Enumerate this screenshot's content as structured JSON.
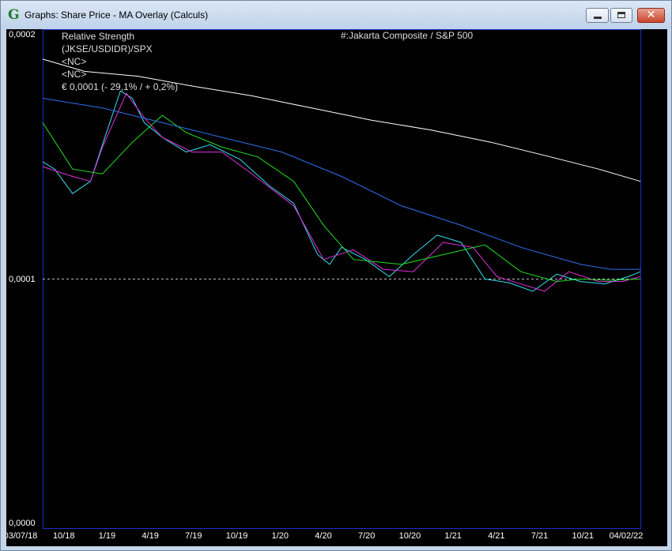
{
  "window": {
    "title": "Graphs: Share Price - MA Overlay (Calculs)",
    "icon": "G",
    "close_glyph": "✕"
  },
  "legend": {
    "lines": [
      "Relative Strength",
      "(JKSE/USDIDR)/SPX",
      "<NC>",
      "<NC>",
      "€ 0,0001 (- 29,1% / + 0,2%)"
    ],
    "series_title": "#:Jakarta Composite / S&P 500"
  },
  "chart_data": {
    "type": "line",
    "y_axis": {
      "ticks": [
        "0,0002",
        "0,0001",
        "0,0000"
      ],
      "ylim": [
        0,
        0.0002
      ],
      "reference_line": 0.0001
    },
    "x_axis": {
      "ticks": [
        "03/07/18",
        "10/18",
        "1/19",
        "4/19",
        "7/19",
        "10/19",
        "1/20",
        "4/20",
        "7/20",
        "10/20",
        "1/21",
        "4/21",
        "7/21",
        "10/21",
        "04/02/22"
      ],
      "range": [
        "2018-07-03",
        "2022-02-04"
      ]
    },
    "grid": false,
    "series": [
      {
        "color": "#33e0f0",
        "x": [
          0,
          0.02,
          0.05,
          0.08,
          0.1,
          0.13,
          0.15,
          0.17,
          0.2,
          0.24,
          0.28,
          0.33,
          0.38,
          0.42,
          0.46,
          0.48,
          0.5,
          0.54,
          0.58,
          0.62,
          0.66,
          0.7,
          0.74,
          0.78,
          0.82,
          0.86,
          0.9,
          0.94,
          0.98,
          1.0
        ],
        "values": [
          0.000148,
          0.000145,
          0.000135,
          0.00014,
          0.000155,
          0.000177,
          0.000174,
          0.000164,
          0.000158,
          0.000152,
          0.000155,
          0.000149,
          0.000138,
          0.000131,
          0.00011,
          0.000106,
          0.000113,
          0.000108,
          0.000101,
          0.00011,
          0.000118,
          0.000115,
          0.0001,
          9.85e-05,
          9.5e-05,
          0.000102,
          9.9e-05,
          9.8e-05,
          0.000101,
          0.000103
        ]
      },
      {
        "color": "#e030e0",
        "x": [
          0,
          0.05,
          0.08,
          0.1,
          0.14,
          0.17,
          0.2,
          0.25,
          0.3,
          0.35,
          0.42,
          0.47,
          0.52,
          0.57,
          0.62,
          0.67,
          0.72,
          0.76,
          0.8,
          0.84,
          0.88,
          0.93,
          0.97,
          1.0
        ],
        "values": [
          0.000146,
          0.000142,
          0.00014,
          0.000154,
          0.000176,
          0.000166,
          0.000158,
          0.000152,
          0.000152,
          0.000143,
          0.00013,
          0.000108,
          0.000112,
          0.000104,
          0.000103,
          0.000115,
          0.000113,
          0.000101,
          9.8e-05,
          9.5e-05,
          0.000103,
          9.9e-05,
          9.9e-05,
          0.000101
        ]
      },
      {
        "color": "#20e020",
        "x": [
          0,
          0.05,
          0.1,
          0.15,
          0.2,
          0.24,
          0.3,
          0.36,
          0.42,
          0.47,
          0.52,
          0.6,
          0.67,
          0.74,
          0.8,
          0.86,
          0.9,
          0.95,
          1.0
        ],
        "values": [
          0.000164,
          0.000145,
          0.000143,
          0.000156,
          0.000167,
          0.00016,
          0.000154,
          0.00015,
          0.00014,
          0.000122,
          0.000108,
          0.000106,
          0.00011,
          0.000114,
          0.000103,
          9.9e-05,
          0.0001,
          9.95e-05,
          0.0001
        ]
      },
      {
        "color": "#3070f0",
        "x": [
          0,
          0.1,
          0.2,
          0.3,
          0.4,
          0.5,
          0.6,
          0.7,
          0.8,
          0.9,
          0.95,
          1.0
        ],
        "values": [
          0.000174,
          0.00017,
          0.000164,
          0.000158,
          0.000152,
          0.000142,
          0.00013,
          0.000122,
          0.000113,
          0.000106,
          0.000104,
          0.000104
        ]
      },
      {
        "color": "#ffffff",
        "x": [
          0,
          0.07,
          0.16,
          0.25,
          0.35,
          0.45,
          0.55,
          0.65,
          0.75,
          0.85,
          0.93,
          1.0
        ],
        "values": [
          0.00019,
          0.000185,
          0.000183,
          0.000179,
          0.000175,
          0.00017,
          0.000165,
          0.000161,
          0.000156,
          0.00015,
          0.000145,
          0.00014
        ]
      }
    ]
  }
}
